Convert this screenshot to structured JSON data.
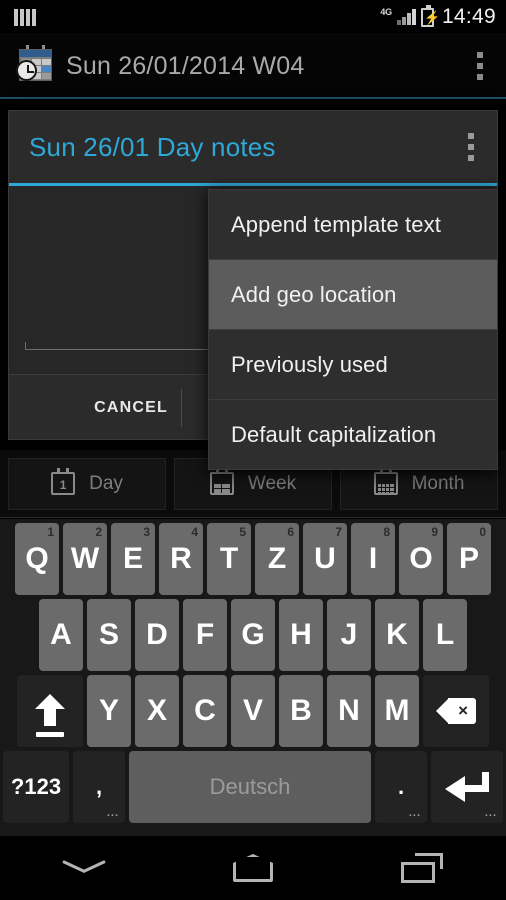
{
  "status_bar": {
    "notification_icon": "bars-icon",
    "network_label": "4G",
    "signal_icon": "signal-icon",
    "battery_icon": "battery-charging-icon",
    "time": "14:49"
  },
  "action_bar": {
    "app_icon": "calendar-clock-icon",
    "title": "Sun 26/01/2014 W04",
    "overflow_icon": "overflow-menu-icon"
  },
  "dialog": {
    "title": "Sun 26/01 Day notes",
    "overflow_icon": "overflow-menu-icon",
    "note_value": "",
    "note_placeholder": "",
    "cancel_label": "CANCEL"
  },
  "menu": {
    "items": [
      {
        "label": "Append template text",
        "selected": false
      },
      {
        "label": "Add geo location",
        "selected": true
      },
      {
        "label": "Previously used",
        "selected": false
      },
      {
        "label": "Default capitalization",
        "selected": false
      }
    ]
  },
  "tabs": [
    {
      "label": "Day",
      "icon": "calendar-day-icon"
    },
    {
      "label": "Week",
      "icon": "calendar-week-icon"
    },
    {
      "label": "Month",
      "icon": "calendar-month-icon"
    }
  ],
  "keyboard": {
    "language": "Deutsch",
    "row1": [
      {
        "key": "Q",
        "num": "1"
      },
      {
        "key": "W",
        "num": "2"
      },
      {
        "key": "E",
        "num": "3"
      },
      {
        "key": "R",
        "num": "4"
      },
      {
        "key": "T",
        "num": "5"
      },
      {
        "key": "Z",
        "num": "6"
      },
      {
        "key": "U",
        "num": "7"
      },
      {
        "key": "I",
        "num": "8"
      },
      {
        "key": "O",
        "num": "9"
      },
      {
        "key": "P",
        "num": "0"
      }
    ],
    "row2": [
      "A",
      "S",
      "D",
      "F",
      "G",
      "H",
      "J",
      "K",
      "L"
    ],
    "row3": [
      "Y",
      "X",
      "C",
      "V",
      "B",
      "N",
      "M"
    ],
    "shift_icon": "shift-icon",
    "backspace_icon": "backspace-icon",
    "symbols_label": "?123",
    "comma_label": ",",
    "period_label": ".",
    "enter_icon": "enter-icon",
    "more_hint": "..."
  },
  "nav_bar": {
    "back_icon": "hide-keyboard-icon",
    "home_icon": "home-icon",
    "recents_icon": "recents-icon"
  },
  "colors": {
    "accent": "#2fa8d8",
    "menu_bg": "#2e2e2e",
    "menu_selected_bg": "#5c5c5c",
    "key_bg": "#6b6b6b",
    "dialog_bg": "#2b2b2b"
  }
}
